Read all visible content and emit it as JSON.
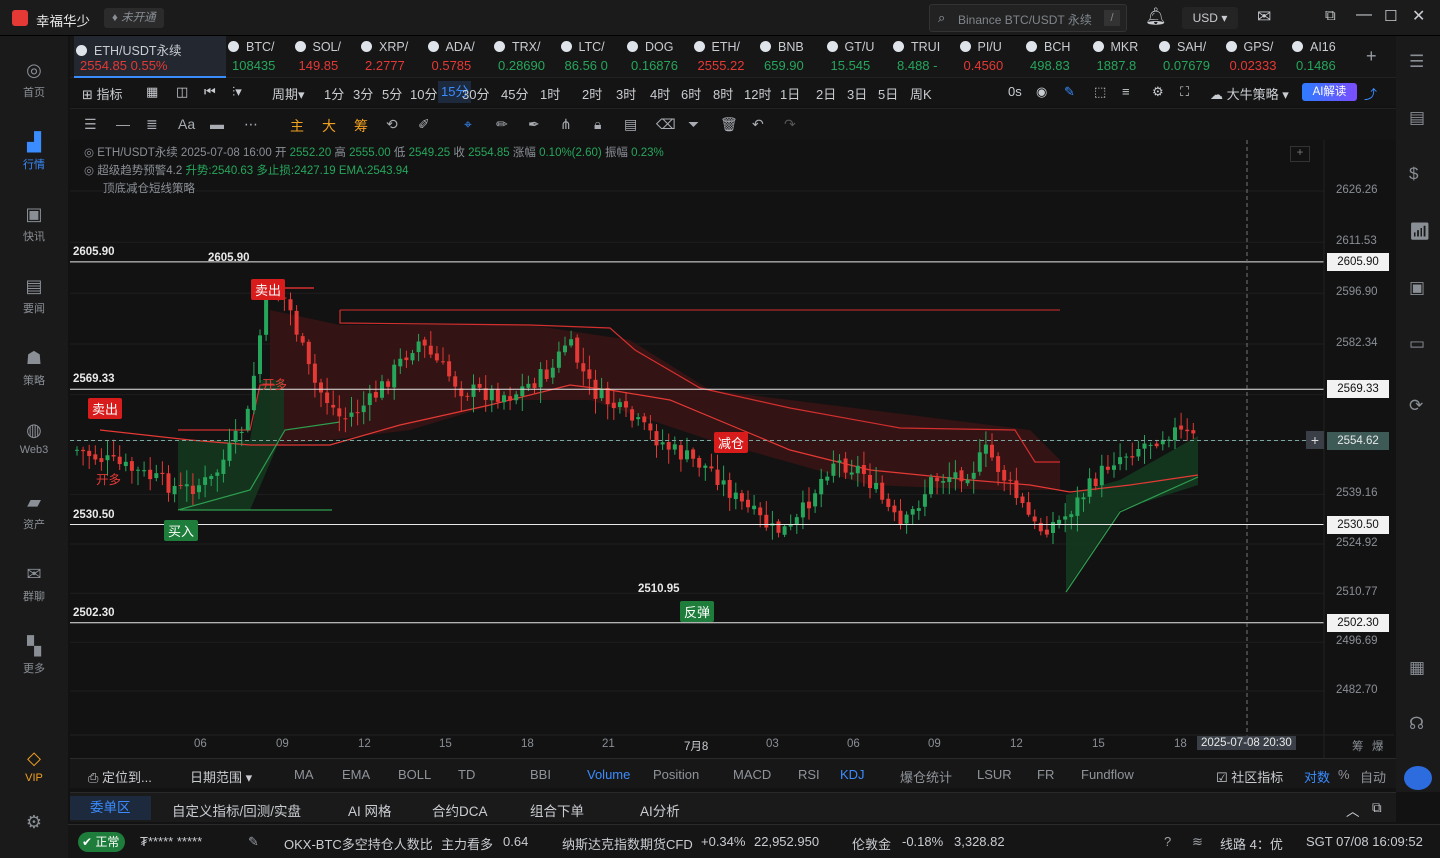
{
  "app": {
    "title": "幸福华少",
    "badge": "未开通",
    "search_placeholder": "Binance BTC/USDT 永续",
    "search_hotkey": "/",
    "currency": "USD"
  },
  "leftnav": [
    {
      "label": "首页",
      "icon": "home-icon"
    },
    {
      "label": "行情",
      "icon": "chart-bars-icon",
      "active": true
    },
    {
      "label": "快讯",
      "icon": "news-icon"
    },
    {
      "label": "要闻",
      "icon": "document-icon"
    },
    {
      "label": "策略",
      "icon": "robot-icon"
    },
    {
      "label": "Web3",
      "icon": "web3-icon"
    },
    {
      "label": "资产",
      "icon": "wallet-icon"
    },
    {
      "label": "群聊",
      "icon": "chat-icon"
    },
    {
      "label": "更多",
      "icon": "grid-icon"
    },
    {
      "label": "VIP",
      "icon": "diamond-icon"
    }
  ],
  "tickers": [
    {
      "name": "ETH/USDT永续",
      "price": "2554.85",
      "change": "0.55%",
      "dir": "dn",
      "active": true
    },
    {
      "name": "BTC/",
      "price": "108435",
      "dir": "up"
    },
    {
      "name": "SOL/",
      "price": "149.85",
      "dir": "dn"
    },
    {
      "name": "XRP/",
      "price": "2.2777",
      "dir": "dn"
    },
    {
      "name": "ADA/",
      "price": "0.5785",
      "dir": "dn"
    },
    {
      "name": "TRX/",
      "price": "0.28690",
      "dir": "up"
    },
    {
      "name": "LTC/",
      "price": "86.56 0",
      "dir": "up"
    },
    {
      "name": "DOG",
      "price": "0.16876",
      "dir": "up"
    },
    {
      "name": "ETH/",
      "price": "2555.22",
      "dir": "dn"
    },
    {
      "name": "BNB",
      "price": "659.90",
      "dir": "up"
    },
    {
      "name": "GT/U",
      "price": "15.545",
      "dir": "up"
    },
    {
      "name": "TRUI",
      "price": "8.488 -",
      "dir": "up"
    },
    {
      "name": "PI/U",
      "price": "0.4560",
      "dir": "dn"
    },
    {
      "name": "BCH",
      "price": "498.83",
      "dir": "up"
    },
    {
      "name": "MKR",
      "price": "1887.8",
      "dir": "up"
    },
    {
      "name": "SAH/",
      "price": "0.07679",
      "dir": "up"
    },
    {
      "name": "GPS/",
      "price": "0.02333",
      "dir": "dn"
    },
    {
      "name": "AI16",
      "price": "0.1486",
      "dir": "up"
    }
  ],
  "toolbar": {
    "indicator": "指标",
    "period": "周期",
    "timeframes": [
      "1分",
      "3分",
      "5分",
      "10分",
      "15分",
      "30分",
      "45分",
      "1时",
      "2时",
      "3时",
      "4时",
      "6时",
      "8时",
      "12时",
      "1日",
      "2日",
      "3日",
      "5日",
      "周K"
    ],
    "selected_tf": "15分",
    "countdown": "0s",
    "strategy": "大牛策略",
    "ai_button": "AI解读"
  },
  "drawtools": {
    "main": "主",
    "big": "大",
    "chip": "筹"
  },
  "info": {
    "line1_symbol": "ETH/USDT永续 2025-07-08 16:00",
    "open_label": "开",
    "open": "2552.20",
    "high_label": "高",
    "high": "2555.00",
    "low_label": "低",
    "low": "2549.25",
    "close_label": "收",
    "close": "2554.85",
    "chg_label": "涨幅",
    "chg": "0.10%(2.60)",
    "amp_label": "振幅",
    "amp": "0.23%",
    "line2_name": "超级趋势预警4.2",
    "line2_up": "升势:2540.63",
    "line2_sl": "多止损:2427.19",
    "line2_ema": "EMA:2543.94",
    "line3": "顶底减仓短线策略"
  },
  "chart_data": {
    "type": "candlestick",
    "symbol": "ETH/USDT永续",
    "interval": "15分",
    "y_ticks": [
      "2626.26",
      "2611.53",
      "2596.90",
      "2582.34",
      "2567.78",
      "2554.62",
      "2539.16",
      "2524.92",
      "2510.77",
      "2496.69",
      "2482.70"
    ],
    "x_ticks": [
      "06",
      "09",
      "12",
      "15",
      "18",
      "21",
      "7月8",
      "03",
      "06",
      "09",
      "12",
      "15",
      "18"
    ],
    "crosshair_time": "2025-07-08 20:30",
    "current_price": "2554.62",
    "levels": [
      {
        "value": "2605.90",
        "left_label": "2605.90"
      },
      {
        "value": "2569.33",
        "left_label": "2569.33"
      },
      {
        "value": "2530.50",
        "left_label": "2530.50"
      },
      {
        "value": "2502.30",
        "left_label": "2502.30"
      }
    ],
    "annotations": {
      "high_mark": "2605.90",
      "low_mark": "2510.95"
    },
    "signals": [
      {
        "text": "卖出",
        "color": "red"
      },
      {
        "text": "卖出",
        "color": "red"
      },
      {
        "text": "买入",
        "color": "green"
      },
      {
        "text": "减仓",
        "color": "red"
      },
      {
        "text": "反弹",
        "color": "green"
      },
      {
        "text": "开多",
        "color": "red"
      },
      {
        "text": "开多",
        "color": "red"
      }
    ],
    "colors": {
      "up": "#26a65b",
      "down": "#e53935",
      "ema": "#e53935",
      "supertrend_up": "#2e9e4f"
    }
  },
  "indicator_tabs": {
    "locate": "定位到...",
    "range": "日期范围",
    "items": [
      "MA",
      "EMA",
      "BOLL",
      "TD",
      "BBI",
      "Volume",
      "Position",
      "MACD",
      "RSI",
      "KDJ",
      "爆仓统计",
      "LSUR",
      "FR",
      "Fundflow"
    ],
    "selected": [
      "Volume",
      "KDJ"
    ],
    "community": "社区指标",
    "log": "对数",
    "pct": "%",
    "auto": "自动",
    "right_a": "筹",
    "right_b": "爆"
  },
  "order_tabs": [
    "委单区",
    "自定义指标/回测/实盘",
    "AI 网格",
    "合约DCA",
    "组合下单",
    "AI分析"
  ],
  "status": {
    "state": "正常",
    "user": "₮***** *****",
    "items": [
      {
        "label": "OKX-BTC多空持仓人数比",
        "extra": "主力看多",
        "value": "0.64"
      },
      {
        "label": "纳斯达克指数期货CFD",
        "change": "+0.34%",
        "value": "22,952.950"
      },
      {
        "label": "伦敦金",
        "change": "-0.18%",
        "value": "3,328.82"
      }
    ],
    "line": "线路 4：优",
    "time": "SGT 07/08 16:09:52"
  }
}
